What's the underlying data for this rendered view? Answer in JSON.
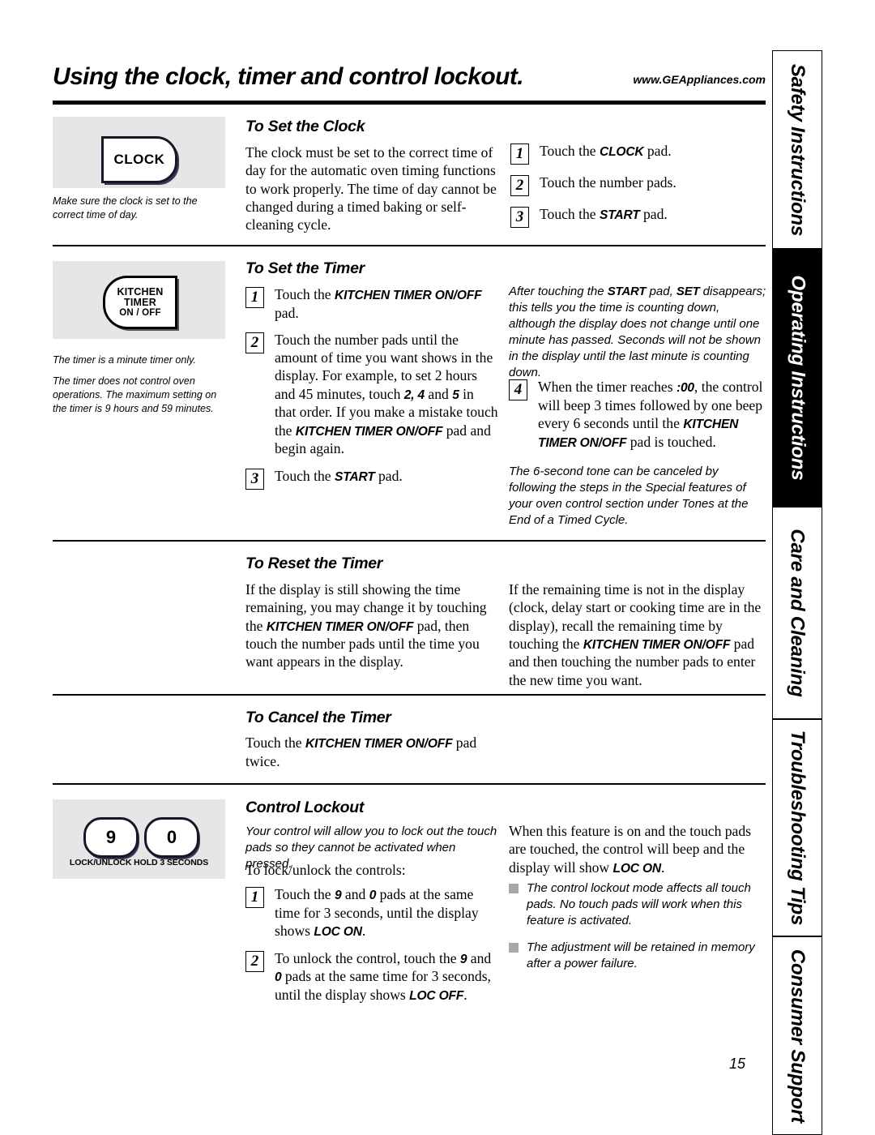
{
  "header": {
    "title": "Using the clock, timer and control lockout.",
    "url": "www.GEAppliances.com"
  },
  "page_number": "15",
  "side_tabs": [
    {
      "label": "Safety Instructions",
      "active": false
    },
    {
      "label": "Operating Instructions",
      "active": true
    },
    {
      "label": "Care and Cleaning",
      "active": false
    },
    {
      "label": "Troubleshooting Tips",
      "active": false
    },
    {
      "label": "Consumer Support",
      "active": false
    }
  ],
  "sections": {
    "set_clock": {
      "heading": "To Set the Clock",
      "body": "The clock must be set to the correct time of day for the automatic oven timing functions to work properly. The time of day cannot be changed during a timed baking or self-cleaning cycle.",
      "pad_label": "CLOCK",
      "note": "Make sure the clock is set to the correct time of day.",
      "steps": [
        {
          "num": "1",
          "pre": "Touch the ",
          "bold": "CLOCK",
          "post": " pad."
        },
        {
          "num": "2",
          "pre": "Touch the number  pads.",
          "bold": "",
          "post": ""
        },
        {
          "num": "3",
          "pre": "Touch the ",
          "bold": "START",
          "post": " pad."
        }
      ]
    },
    "set_timer": {
      "heading": "To Set the Timer",
      "pad_line1": "KITCHEN",
      "pad_line2": "TIMER",
      "pad_line3": "ON / OFF",
      "note1": "The timer is a minute timer only.",
      "note2": "The timer does not control oven operations. The maximum setting on the timer is 9 hours and 59 minutes.",
      "step1_num": "1",
      "step1_a": "Touch the ",
      "step1_b": "KITCHEN TIMER ON/OFF",
      "step1_c": " pad.",
      "step2_num": "2",
      "step2_a": "Touch the number pads until the amount of time you want shows in the display. For example, to set 2 hours and 45 minutes, touch ",
      "step2_b": "2, 4",
      "step2_c": " and ",
      "step2_d": "5",
      "step2_e": " in that order. If you make a mistake touch the ",
      "step2_f": "KITCHEN TIMER ON/OFF",
      "step2_g": " pad and begin again.",
      "step3_num": "3",
      "step3_a": "Touch the ",
      "step3_b": "START",
      "step3_c": " pad.",
      "right_note_a": "After touching the ",
      "right_note_b": "START",
      "right_note_c": " pad, ",
      "right_note_d": "SET",
      "right_note_e": " disappears; this tells you the time is counting down, although the display does not change until one minute has passed. Seconds will not be shown in the display until the last minute is counting down.",
      "step4_num": "4",
      "step4_a": "When the timer reaches ",
      "step4_b": ":00",
      "step4_c": ", the control will beep 3 times followed by one beep every 6 seconds until the ",
      "step4_d": "KITCHEN TIMER ON/OFF",
      "step4_e": " pad is touched.",
      "tone_note": "The 6-second tone can be canceled by following the steps in the Special features of your oven control section under Tones at the End of a Timed Cycle."
    },
    "reset_timer": {
      "heading": "To Reset the Timer",
      "left_a": "If the display is still showing the time remaining, you may change it by touching the ",
      "left_b": "KITCHEN TIMER ON/OFF",
      "left_c": " pad, then touch the number pads until the time you want appears in the display.",
      "right_a": "If the remaining time is not in the display (clock, delay start or cooking time are in the display), recall the remaining time by touching the ",
      "right_b": "KITCHEN TIMER ON/OFF",
      "right_c": " pad and then touching the number pads to enter the new time you want."
    },
    "cancel_timer": {
      "heading": "To Cancel the Timer",
      "body_a": "Touch the ",
      "body_b": "KITCHEN TIMER ON/OFF",
      "body_c": " pad twice."
    },
    "control_lockout": {
      "heading": "Control Lockout",
      "pad_9": "9",
      "pad_0": "0",
      "pad_caption": "LOCK/UNLOCK HOLD 3 SECONDS",
      "intro_italic": "Your control will allow you to lock out the touch pads so they cannot be activated when pressed.",
      "lead": "To lock/unlock the controls:",
      "step1_num": "1",
      "step1_a": "Touch the ",
      "step1_b": "9",
      "step1_c": " and ",
      "step1_d": "0",
      "step1_e": " pads at the same time for 3 seconds, until the display shows ",
      "step1_f": "LOC ON",
      "step1_g": ".",
      "step2_num": "2",
      "step2_a": "To unlock the control, touch the ",
      "step2_b": "9",
      "step2_c": " and ",
      "step2_d": "0",
      "step2_e": " pads at the same time for 3 seconds, until the display shows ",
      "step2_f": "LOC OFF",
      "step2_g": ".",
      "right_a": "When this feature is on and the touch pads are touched, the control will beep and the display will show ",
      "right_b": "LOC ON",
      "right_c": ".",
      "bullets": [
        "The control lockout mode affects all touch pads. No touch pads will work when this feature is activated.",
        "The adjustment will be retained in memory after a power failure."
      ]
    }
  }
}
